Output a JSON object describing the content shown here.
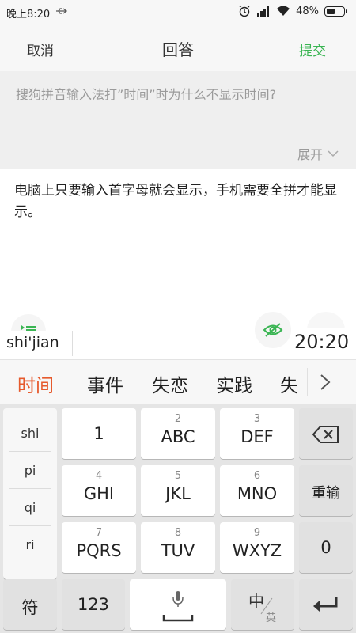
{
  "status_bar": {
    "time": "晚上8:20",
    "battery": "48%",
    "battery_level": 0.48
  },
  "header": {
    "cancel_label": "取消",
    "title": "回答",
    "submit_label": "提交",
    "accent_color": "#3ab553"
  },
  "question": {
    "text": "搜狗拼音输入法打”时间”时为什么不显示时间?",
    "expand_label": "展开"
  },
  "answer": {
    "text": "电脑上只要输入首字母就会显示，手机需要全拼才能显示。"
  },
  "ime": {
    "composing_text": "shi'jian",
    "time_preview": "20:20",
    "candidates": [
      "时间",
      "事件",
      "失恋",
      "实践",
      "失"
    ],
    "active_candidate_color": "#e65a2d"
  },
  "keyboard": {
    "side_list": [
      "shi",
      "pi",
      "qi",
      "ri"
    ],
    "keys": {
      "k1": {
        "label": "1"
      },
      "k2": {
        "num": "2",
        "label": "ABC"
      },
      "k3": {
        "num": "3",
        "label": "DEF"
      },
      "k4": {
        "num": "4",
        "label": "GHI"
      },
      "k5": {
        "num": "5",
        "label": "JKL"
      },
      "k6": {
        "num": "6",
        "label": "MNO"
      },
      "k7": {
        "num": "7",
        "label": "PQRS"
      },
      "k8": {
        "num": "8",
        "label": "TUV"
      },
      "k9": {
        "num": "9",
        "label": "WXYZ"
      }
    },
    "reinput_label": "重输",
    "zero_label": "0",
    "symbol_label": "符",
    "numeric_label": "123",
    "lang_label_cn": "中",
    "lang_label_en": "英"
  },
  "icons": {
    "usb": "usb-icon",
    "alarm": "alarm-icon",
    "signal": "signal-icon",
    "wifi": "wifi-icon",
    "battery": "battery-icon",
    "expand": "chevron-down-icon",
    "list": "list-icon",
    "eye": "eye-off-icon",
    "more_candidates": "chevron-right-icon",
    "backspace": "backspace-icon",
    "microphone": "microphone-icon",
    "enter": "enter-icon"
  }
}
